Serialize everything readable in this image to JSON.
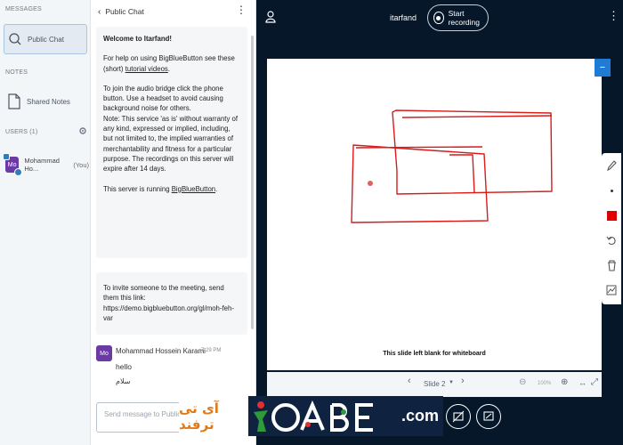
{
  "userlist": {
    "messages_heading": "MESSAGES",
    "public_chat_label": "Public Chat",
    "notes_heading": "NOTES",
    "shared_notes_label": "Shared Notes",
    "users_heading": "USERS (1)",
    "user": {
      "initials": "Mo",
      "name": "Mohammad Ho...",
      "you": "(You)"
    }
  },
  "chat": {
    "title": "Public Chat",
    "welcome_title": "Welcome to Itarfand!",
    "help_prefix": "For help on using BigBlueButton see these (short) ",
    "help_link": "tutorial videos",
    "help_suffix": ".",
    "audio_text": "To join the audio bridge click the phone button. Use a headset to avoid causing background noise for others.",
    "note_text": "Note: This service 'as is' without warranty of any kind, expressed or implied, including, but not limited to, the implied warranties of merchantability and fitness for a particular purpose. The recordings on this server will expire after 14 days.",
    "running_prefix": "This server is running ",
    "running_link": "BigBlueButton",
    "running_suffix": ".",
    "invite_text": "To invite someone to the meeting, send them this link:",
    "invite_url": "https://demo.bigbluebutton.org/gl/moh-feh-var",
    "message": {
      "initials": "Mo",
      "sender": "Mohammad Hossein Karami",
      "time": "7:29 PM",
      "line1": "hello",
      "line2": "سلام"
    },
    "input_placeholder": "Send message to Public Chat"
  },
  "topbar": {
    "meeting_name": "itarfand",
    "record_label": "Start recording"
  },
  "whiteboard": {
    "caption": "This slide left blank for whiteboard",
    "min_icon": "minus-icon",
    "pen_color": "#e00000"
  },
  "slide_controls": {
    "slide_label": "Slide 2",
    "zoom": "100%"
  },
  "watermark": {
    "persian": "آی تی ترفند",
    "letters": "CABE",
    "domain": ".com"
  },
  "colors": {
    "accent": "#1f7bd6",
    "dark_bg": "#06172a",
    "avatar": "#6b3aa5",
    "drawing": "#d81b1b"
  }
}
